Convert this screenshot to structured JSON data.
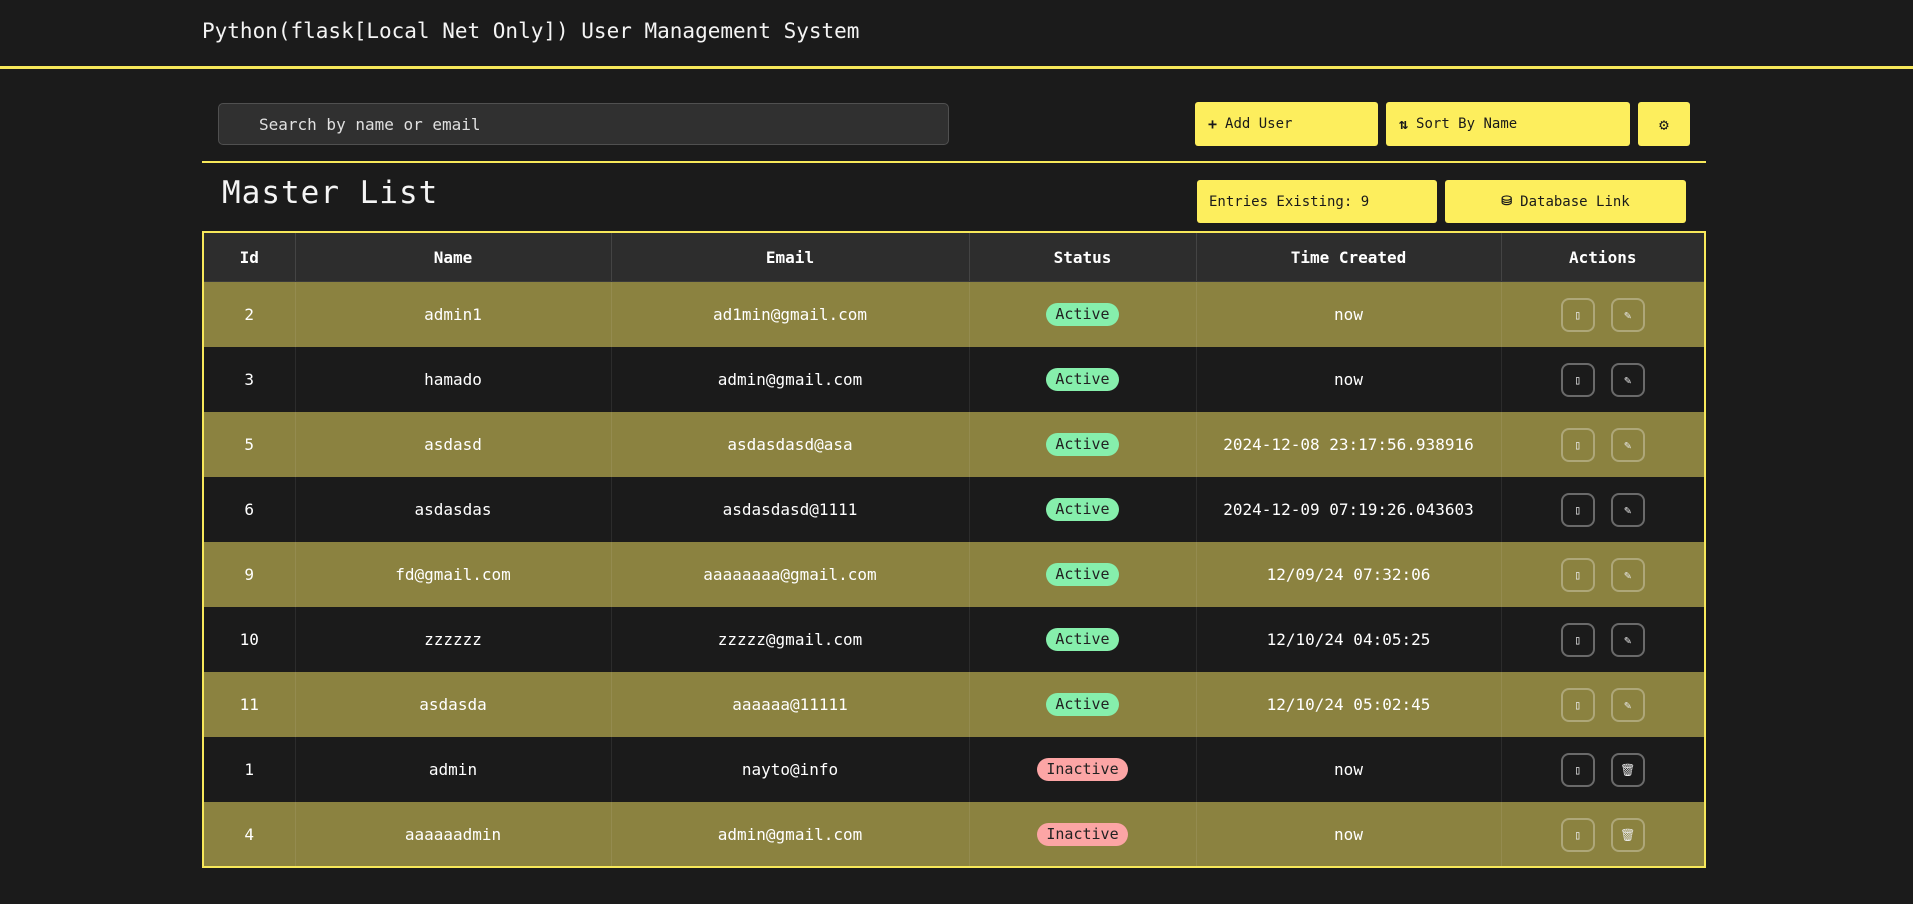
{
  "header": {
    "title": "Python(flask[Local Net Only]) User Management System"
  },
  "toolbar": {
    "search_placeholder": "Search by name or email",
    "add_user_label": "Add User",
    "sort_label": "Sort By Name",
    "add_icon": "plus-icon",
    "sort_icon": "sort-icon",
    "settings_icon": "gear-icon"
  },
  "section": {
    "title": "Master List",
    "entries_label": "Entries Existing: 9",
    "db_link_label": "Database Link",
    "db_icon": "database-icon"
  },
  "table": {
    "headers": [
      "Id",
      "Name",
      "Email",
      "Status",
      "Time Created",
      "Actions"
    ],
    "rows": [
      {
        "id": "2",
        "name": "admin1",
        "email": "ad1min@gmail.com",
        "status": "Active",
        "time": "now"
      },
      {
        "id": "3",
        "name": "hamado",
        "email": "admin@gmail.com",
        "status": "Active",
        "time": "now"
      },
      {
        "id": "5",
        "name": "asdasd",
        "email": "asdasdasd@asa",
        "status": "Active",
        "time": "2024-12-08 23:17:56.938916"
      },
      {
        "id": "6",
        "name": "asdasdas",
        "email": "asdasdasd@1111",
        "status": "Active",
        "time": "2024-12-09 07:19:26.043603"
      },
      {
        "id": "9",
        "name": "fd@gmail.com",
        "email": "aaaaaaaa@gmail.com",
        "status": "Active",
        "time": "12/09/24 07:32:06"
      },
      {
        "id": "10",
        "name": "zzzzzz",
        "email": "zzzzz@gmail.com",
        "status": "Active",
        "time": "12/10/24 04:05:25"
      },
      {
        "id": "11",
        "name": "asdasda",
        "email": "aaaaaa@11111",
        "status": "Active",
        "time": "12/10/24 05:02:45"
      },
      {
        "id": "1",
        "name": "admin",
        "email": "nayto@info",
        "status": "Inactive",
        "time": "now"
      },
      {
        "id": "4",
        "name": "aaaaaadmin",
        "email": "admin@gmail.com",
        "status": "Inactive",
        "time": "now"
      }
    ]
  },
  "colors": {
    "accent": "#fdee5d",
    "row_highlight": "#8b8240",
    "background": "#1b1b1b",
    "active_badge": "#86efac",
    "inactive_badge": "#fca5a5"
  }
}
